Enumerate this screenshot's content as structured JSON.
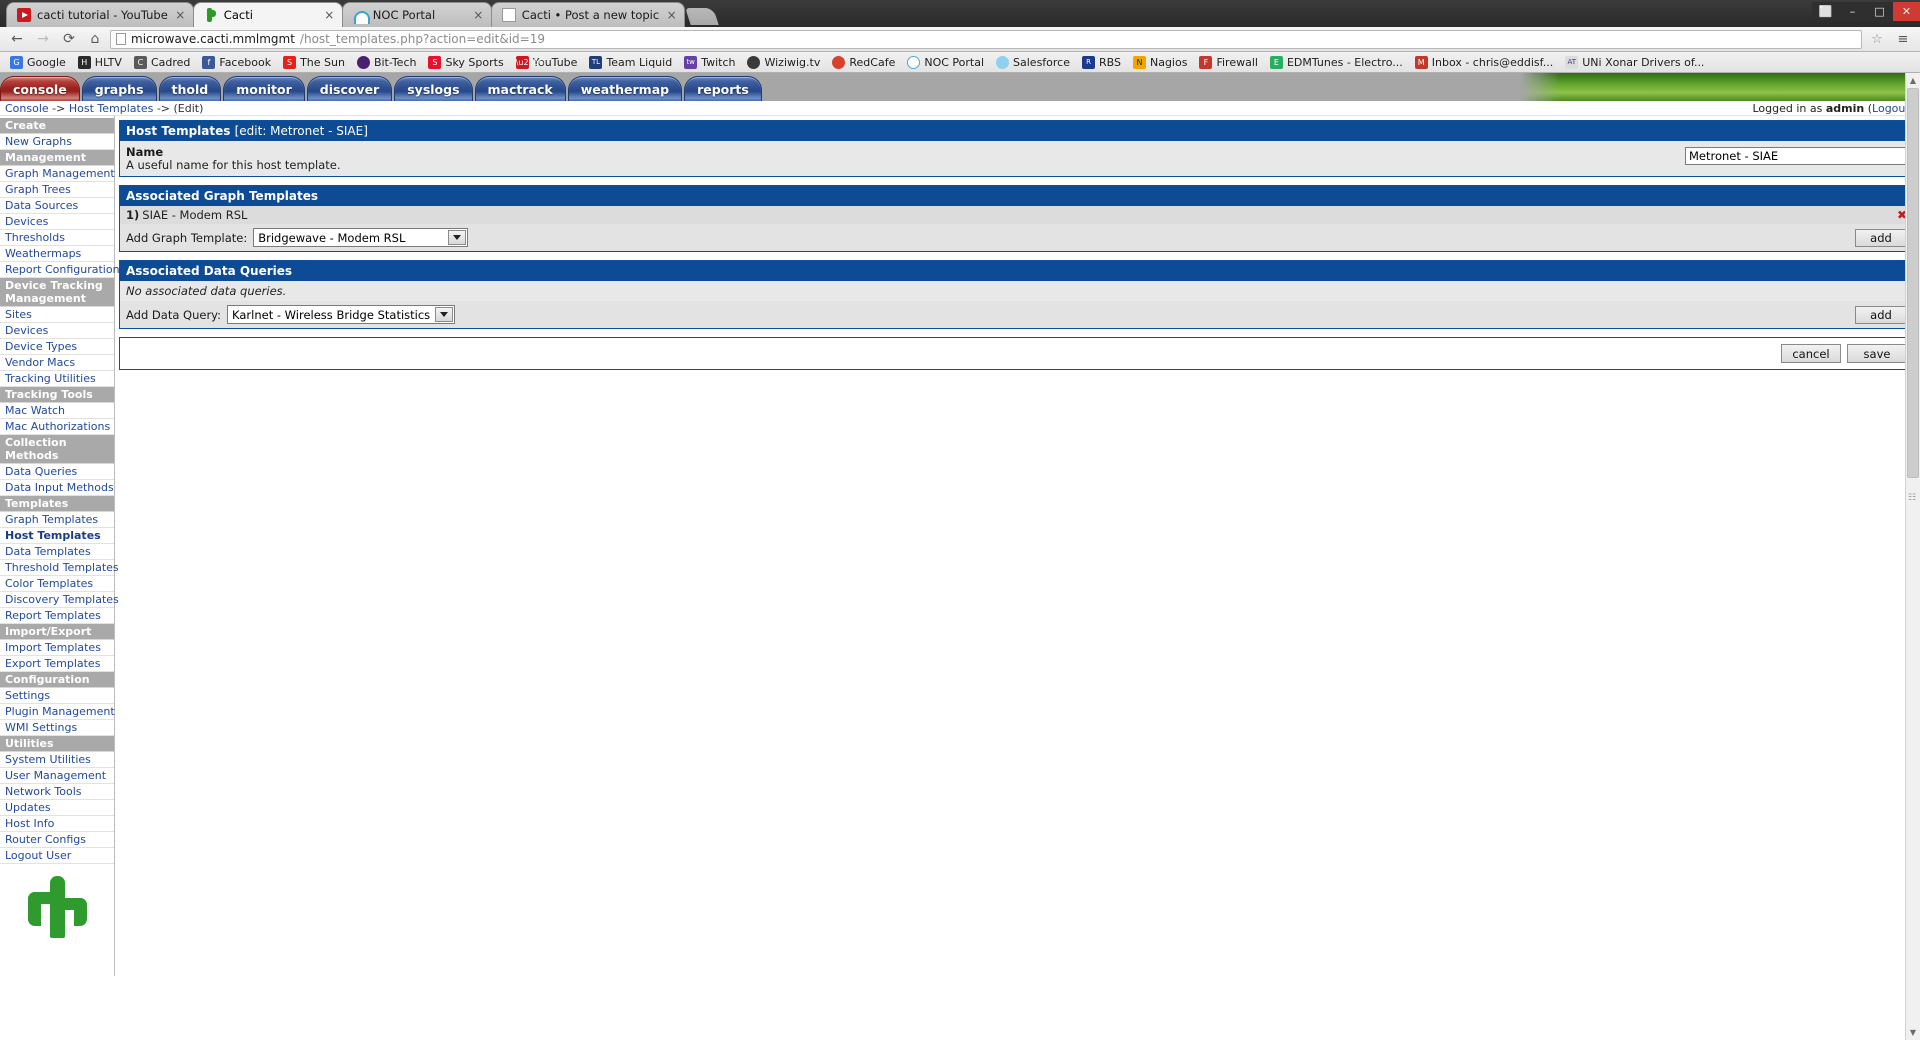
{
  "browser": {
    "tabs": [
      {
        "title": "cacti tutorial - YouTube",
        "icon": "youtube-icon",
        "active": false,
        "close": "×"
      },
      {
        "title": "Cacti",
        "icon": "cacti-icon",
        "active": true,
        "close": "×"
      },
      {
        "title": "NOC Portal",
        "icon": "noc-icon",
        "active": false,
        "close": "×"
      },
      {
        "title": "Cacti • Post a new topic",
        "icon": "document-icon",
        "active": false,
        "close": "×"
      }
    ],
    "window_controls": {
      "screenshot": "⬜",
      "minimize": "–",
      "maximize": "□",
      "close": "✕"
    },
    "nav": {
      "back": "←",
      "forward": "→",
      "reload": "⟳",
      "home": "⌂",
      "star": "☆",
      "menu": "≡"
    },
    "url": {
      "host": "microwave.cacti.mmlmgmt",
      "path": "/host_templates.php?action=edit&id=19",
      "full": "microwave.cacti.mmlmgmt/host_templates.php?action=edit&id=19"
    },
    "bookmarks": [
      {
        "label": "Google",
        "icon": "google-icon",
        "color": "#3b76e8",
        "glyph": "G"
      },
      {
        "label": "HLTV",
        "icon": "hltv-icon",
        "color": "#2a2a2a",
        "glyph": "H"
      },
      {
        "label": "Cadred",
        "icon": "cadred-icon",
        "color": "#5a5a5a",
        "glyph": "C"
      },
      {
        "label": "Facebook",
        "icon": "facebook-icon",
        "color": "#3b5998",
        "glyph": "f"
      },
      {
        "label": "The Sun",
        "icon": "thesun-icon",
        "color": "#e1231b",
        "glyph": "S"
      },
      {
        "label": "Bit-Tech",
        "icon": "bittech-icon",
        "color": "#4b1f6f",
        "glyph": "B"
      },
      {
        "label": "Sky Sports",
        "icon": "skysports-icon",
        "color": "#e8112d",
        "glyph": "S"
      },
      {
        "label": "YouTube",
        "icon": "youtube-icon",
        "color": "#cc181e",
        "glyph": "▶"
      },
      {
        "label": "Team Liquid",
        "icon": "teamliquid-icon",
        "color": "#1f3f7a",
        "glyph": "TL"
      },
      {
        "label": "Twitch",
        "icon": "twitch-icon",
        "color": "#6441a5",
        "glyph": "tw"
      },
      {
        "label": "Wiziwig.tv",
        "icon": "wiziwig-icon",
        "color": "#3a3a3a",
        "glyph": "W"
      },
      {
        "label": "RedCafe",
        "icon": "redcafe-icon",
        "color": "#d8402f",
        "glyph": "R"
      },
      {
        "label": "NOC Portal",
        "icon": "noc-icon",
        "color": "#4aa7d6",
        "glyph": "N"
      },
      {
        "label": "Salesforce",
        "icon": "salesforce-icon",
        "color": "#8fd0ef",
        "glyph": "sf"
      },
      {
        "label": "RBS",
        "icon": "rbs-icon",
        "color": "#1b3a8c",
        "glyph": "R"
      },
      {
        "label": "Nagios",
        "icon": "nagios-icon",
        "color": "#f0a500",
        "glyph": "N"
      },
      {
        "label": "Firewall",
        "icon": "firewall-icon",
        "color": "#c0392b",
        "glyph": "F"
      },
      {
        "label": "EDMTunes - Electro...",
        "icon": "edmtunes-icon",
        "color": "#27ae60",
        "glyph": "E"
      },
      {
        "label": "Inbox - chris@eddisf...",
        "icon": "inbox-icon",
        "color": "#c0392b",
        "glyph": "M"
      },
      {
        "label": "UNi Xonar Drivers of...",
        "icon": "asus-icon",
        "color": "#3c3c8c",
        "glyph": "AT"
      }
    ]
  },
  "cacti": {
    "nav_tabs": [
      {
        "label": "console",
        "active": true
      },
      {
        "label": "graphs",
        "active": false
      },
      {
        "label": "thold",
        "active": false
      },
      {
        "label": "monitor",
        "active": false
      },
      {
        "label": "discover",
        "active": false
      },
      {
        "label": "syslogs",
        "active": false
      },
      {
        "label": "mactrack",
        "active": false
      },
      {
        "label": "weathermap",
        "active": false
      },
      {
        "label": "reports",
        "active": false
      }
    ],
    "breadcrumb": {
      "items": [
        "Console",
        "Host Templates",
        "(Edit)"
      ],
      "separator": "->"
    },
    "login_status": {
      "prefix": "Logged in as",
      "user": "admin",
      "logout_open": "(",
      "logout": "Logout",
      "logout_close": ")"
    },
    "sidebar": [
      {
        "type": "header",
        "label": "Create"
      },
      {
        "type": "item",
        "label": "New Graphs"
      },
      {
        "type": "header",
        "label": "Management"
      },
      {
        "type": "item",
        "label": "Graph Management"
      },
      {
        "type": "item",
        "label": "Graph Trees"
      },
      {
        "type": "item",
        "label": "Data Sources"
      },
      {
        "type": "item",
        "label": "Devices"
      },
      {
        "type": "item",
        "label": "Thresholds"
      },
      {
        "type": "item",
        "label": "Weathermaps"
      },
      {
        "type": "item",
        "label": "Report Configurations"
      },
      {
        "type": "header",
        "label": "Device Tracking Management"
      },
      {
        "type": "item",
        "label": "Sites"
      },
      {
        "type": "item",
        "label": "Devices"
      },
      {
        "type": "item",
        "label": "Device Types"
      },
      {
        "type": "item",
        "label": "Vendor Macs"
      },
      {
        "type": "item",
        "label": "Tracking Utilities"
      },
      {
        "type": "header",
        "label": "Tracking Tools"
      },
      {
        "type": "item",
        "label": "Mac Watch"
      },
      {
        "type": "item",
        "label": "Mac Authorizations"
      },
      {
        "type": "header",
        "label": "Collection Methods"
      },
      {
        "type": "item",
        "label": "Data Queries"
      },
      {
        "type": "item",
        "label": "Data Input Methods"
      },
      {
        "type": "header",
        "label": "Templates"
      },
      {
        "type": "item",
        "label": "Graph Templates"
      },
      {
        "type": "item",
        "label": "Host Templates",
        "current": true
      },
      {
        "type": "item",
        "label": "Data Templates"
      },
      {
        "type": "item",
        "label": "Threshold Templates"
      },
      {
        "type": "item",
        "label": "Color Templates"
      },
      {
        "type": "item",
        "label": "Discovery Templates"
      },
      {
        "type": "item",
        "label": "Report Templates"
      },
      {
        "type": "header",
        "label": "Import/Export"
      },
      {
        "type": "item",
        "label": "Import Templates"
      },
      {
        "type": "item",
        "label": "Export Templates"
      },
      {
        "type": "header",
        "label": "Configuration"
      },
      {
        "type": "item",
        "label": "Settings"
      },
      {
        "type": "item",
        "label": "Plugin Management"
      },
      {
        "type": "item",
        "label": "WMI Settings"
      },
      {
        "type": "header",
        "label": "Utilities"
      },
      {
        "type": "item",
        "label": "System Utilities"
      },
      {
        "type": "item",
        "label": "User Management"
      },
      {
        "type": "item",
        "label": "Network Tools"
      },
      {
        "type": "item",
        "label": "Updates"
      },
      {
        "type": "item",
        "label": "Host Info"
      },
      {
        "type": "item",
        "label": "Router Configs"
      },
      {
        "type": "item",
        "label": "Logout User"
      }
    ],
    "host_templates_panel": {
      "title_bold": "Host Templates",
      "title_rest": "[edit: Metronet - SIAE]",
      "name_label": "Name",
      "name_description": "A useful name for this host template.",
      "name_value": "Metronet - SIAE"
    },
    "graph_templates_panel": {
      "title": "Associated Graph Templates",
      "rows": [
        {
          "index": "1)",
          "name": "SIAE - Modem RSL",
          "delete_icon": "✖"
        }
      ],
      "add_label": "Add Graph Template:",
      "add_selected": "Bridgewave - Modem RSL",
      "add_button": "add"
    },
    "data_queries_panel": {
      "title": "Associated Data Queries",
      "empty_note": "No associated data queries.",
      "add_label": "Add Data Query:",
      "add_selected": "Karlnet - Wireless Bridge Statistics",
      "add_button": "add"
    },
    "form_actions": {
      "cancel": "cancel",
      "save": "save"
    },
    "colors": {
      "panel_header": "#0d4c95",
      "tab_active": "#9c2420",
      "tab_inactive": "#2d4f91",
      "link": "#23489c",
      "sidebar_header": "#a9a9a9"
    }
  }
}
